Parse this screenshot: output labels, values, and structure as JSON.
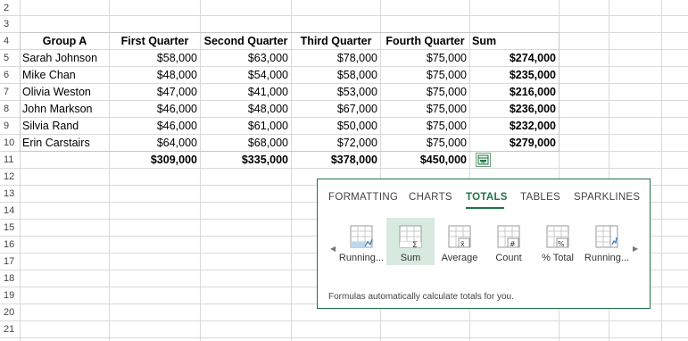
{
  "row_numbers": [
    "2",
    "3",
    "4",
    "5",
    "6",
    "7",
    "8",
    "9",
    "10",
    "11",
    "12",
    "13",
    "14",
    "15",
    "16",
    "17",
    "18",
    "19",
    "20",
    "21"
  ],
  "table": {
    "headers": [
      "Group A",
      "First Quarter",
      "Second Quarter",
      "Third Quarter",
      "Fourth Quarter",
      "Sum"
    ],
    "rows": [
      [
        "Sarah Johnson",
        "$58,000",
        "$63,000",
        "$78,000",
        "$75,000",
        "$274,000"
      ],
      [
        "Mike Chan",
        "$48,000",
        "$54,000",
        "$58,000",
        "$75,000",
        "$235,000"
      ],
      [
        "Olivia Weston",
        "$47,000",
        "$41,000",
        "$53,000",
        "$75,000",
        "$216,000"
      ],
      [
        "John Markson",
        "$46,000",
        "$48,000",
        "$67,000",
        "$75,000",
        "$236,000"
      ],
      [
        "Silvia Rand",
        "$46,000",
        "$61,000",
        "$50,000",
        "$75,000",
        "$232,000"
      ],
      [
        "Erin Carstairs",
        "$64,000",
        "$68,000",
        "$72,000",
        "$75,000",
        "$279,000"
      ]
    ],
    "totals": [
      "$309,000",
      "$335,000",
      "$378,000",
      "$450,000"
    ]
  },
  "quick_analysis": {
    "tabs": [
      "FORMATTING",
      "CHARTS",
      "TOTALS",
      "TABLES",
      "SPARKLINES"
    ],
    "active_tab": "TOTALS",
    "items": [
      {
        "label": "Running...",
        "icon": "running-total-rows-icon"
      },
      {
        "label": "Sum",
        "icon": "sum-icon"
      },
      {
        "label": "Average",
        "icon": "average-icon"
      },
      {
        "label": "Count",
        "icon": "count-icon"
      },
      {
        "label": "% Total",
        "icon": "percent-total-icon"
      },
      {
        "label": "Running...",
        "icon": "running-total-columns-icon"
      }
    ],
    "selected_item": "Sum",
    "description": "Formulas automatically calculate totals for you."
  },
  "colors": {
    "accent": "#217346",
    "selected_bg": "#d8eadf",
    "gridline": "#d9d9d9"
  }
}
